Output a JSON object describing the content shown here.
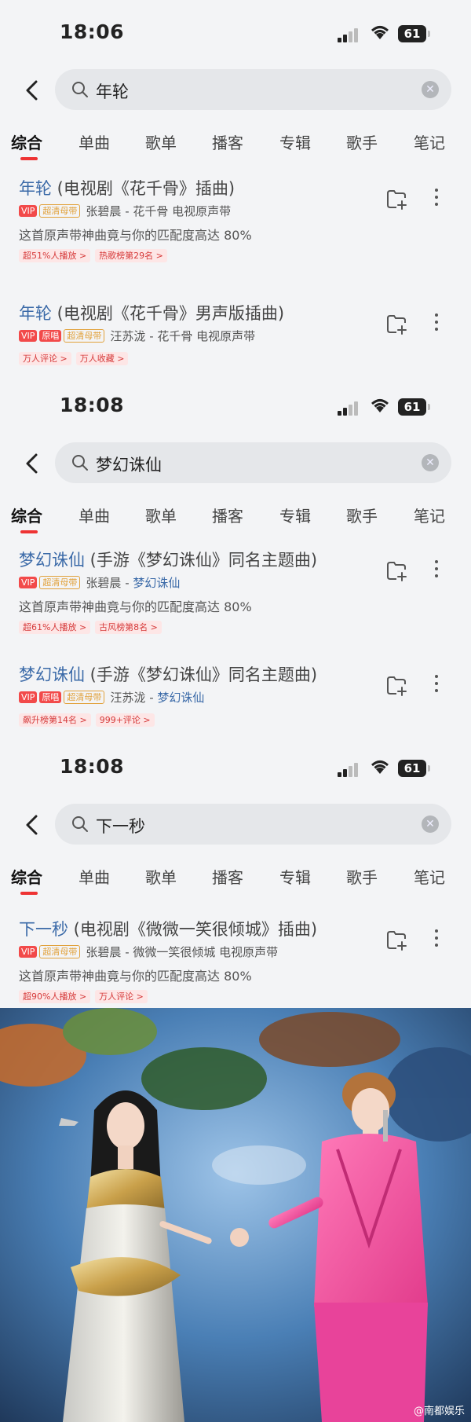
{
  "panels": [
    {
      "time": "18:06",
      "battery": "61",
      "query": "年轮",
      "songs": [
        {
          "title": "年轮",
          "rest": " (电视剧《花千骨》插曲)",
          "badges": [
            "VIP",
            "超清母带"
          ],
          "artist": "张碧晨",
          "sep": " - ",
          "album": "花千骨 电视原声带",
          "desc": "这首原声带神曲竟与你的匹配度高达 80%",
          "tags": [
            "超51%人播放 >",
            "热歌榜第29名 >"
          ]
        },
        {
          "title": "年轮",
          "rest": " (电视剧《花千骨》男声版插曲)",
          "badges": [
            "VIP",
            "原唱",
            "超清母带"
          ],
          "artist": "汪苏泷",
          "sep": " - ",
          "album": "花千骨 电视原声带",
          "desc": "",
          "tags": [
            "万人评论 >",
            "万人收藏 >"
          ]
        }
      ]
    },
    {
      "time": "18:08",
      "battery": "61",
      "query": "梦幻诛仙",
      "songs": [
        {
          "title": "梦幻诛仙",
          "rest": " (手游《梦幻诛仙》同名主题曲)",
          "badges": [
            "VIP",
            "超清母带"
          ],
          "artist": "张碧晨",
          "sep": " - ",
          "album": "梦幻诛仙",
          "desc": "这首原声带神曲竟与你的匹配度高达 80%",
          "tags": [
            "超61%人播放 >",
            "古风榜第8名 >"
          ]
        },
        {
          "title": "梦幻诛仙",
          "rest": " (手游《梦幻诛仙》同名主题曲)",
          "badges": [
            "VIP",
            "原唱",
            "超清母带"
          ],
          "artist": "汪苏泷",
          "sep": " - ",
          "album": "梦幻诛仙",
          "desc": "",
          "tags": [
            "飙升榜第14名 >",
            "999+评论 >"
          ]
        }
      ]
    },
    {
      "time": "18:08",
      "battery": "61",
      "query": "下一秒",
      "songs": [
        {
          "title": "下一秒",
          "rest": " (电视剧《微微一笑很倾城》插曲)",
          "badges": [
            "VIP",
            "超清母带"
          ],
          "artist": "张碧晨",
          "sep": " - ",
          "album": "微微一笑很倾城 电视原声带",
          "desc": "这首原声带神曲竟与你的匹配度高达 80%",
          "tags": [
            "超90%人播放 >",
            "万人评论 >"
          ]
        }
      ]
    }
  ],
  "tabs": [
    "综合",
    "单曲",
    "歌单",
    "播客",
    "专辑",
    "歌手",
    "笔记"
  ],
  "watermark": "@南都娱乐",
  "colors": {
    "accent": "#e33333",
    "link": "#3b6aa8",
    "vip": "#f24a4a",
    "hq": "#e1a13a"
  }
}
